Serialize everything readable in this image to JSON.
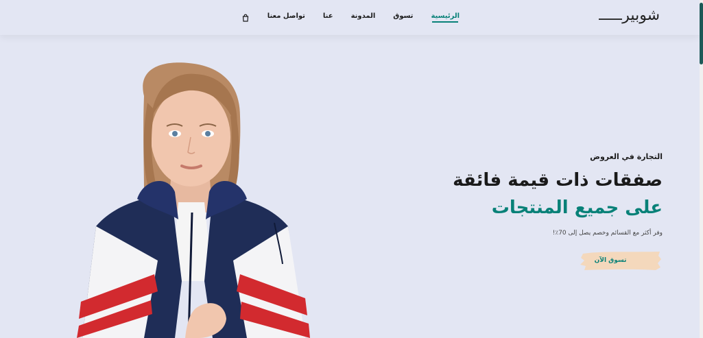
{
  "header": {
    "logo": "شوبير",
    "nav": [
      {
        "id": "home",
        "label": "الرئيسية",
        "active": true
      },
      {
        "id": "shop",
        "label": "تسوق",
        "active": false
      },
      {
        "id": "blog",
        "label": "المدونة",
        "active": false
      },
      {
        "id": "about",
        "label": "عنا",
        "active": false
      },
      {
        "id": "contact",
        "label": "تواصل معنا",
        "active": false
      }
    ],
    "cart_icon": "shopping-bag-icon"
  },
  "hero": {
    "eyebrow": "التجارة في العروض",
    "headline": "صفقات ذات قيمة فائقة",
    "headline_accent": "على جميع المنتجات",
    "subtext": "وفر أكثر مع القسائم وخصم يصل إلى 70٪!",
    "cta_label": "تسوق الآن"
  },
  "colors": {
    "background": "#e3e6f3",
    "accent": "#088178",
    "cta_brush": "#f4d8bc"
  }
}
